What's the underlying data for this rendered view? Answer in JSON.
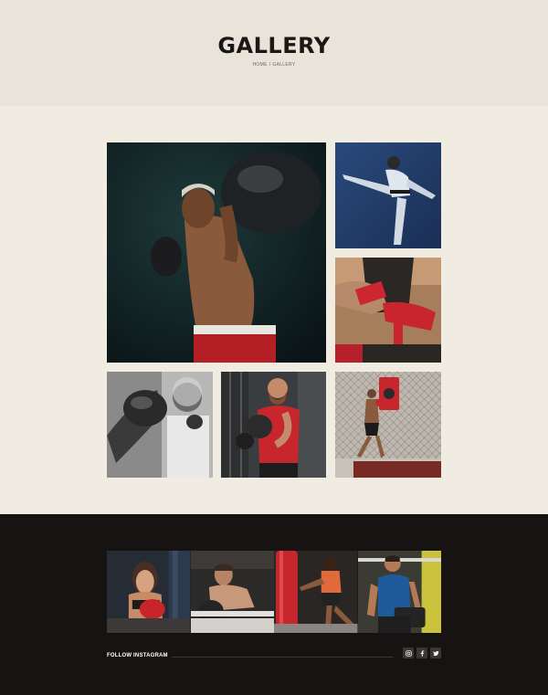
{
  "page": {
    "title": "GALLERY",
    "breadcrumb": {
      "home": "HOME",
      "separator": "/",
      "current": "GALLERY"
    }
  },
  "gallery": {
    "images": [
      {
        "name": "boxer-punch"
      },
      {
        "name": "karate-kick"
      },
      {
        "name": "hand-wraps"
      },
      {
        "name": "kid-boxing-bw"
      },
      {
        "name": "bearded-trainer"
      },
      {
        "name": "cage-kickboxing"
      }
    ]
  },
  "footer": {
    "instagram_label": "FOLLOW INSTAGRAM",
    "social_icons": [
      "instagram-icon",
      "facebook-icon",
      "twitter-icon"
    ]
  },
  "colors": {
    "hero_bg": "#e9e4da",
    "page_bg": "#f1ece1",
    "footer_bg": "#161312",
    "accent_red": "#c8252a"
  }
}
